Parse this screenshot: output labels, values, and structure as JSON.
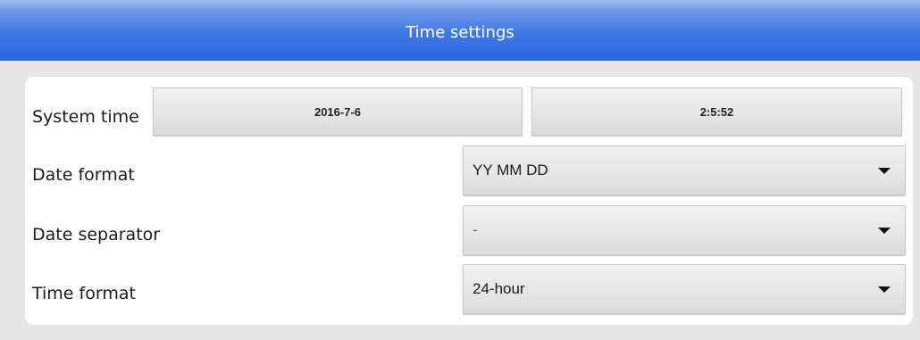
{
  "header": {
    "title": "Time settings"
  },
  "rows": {
    "system_time": {
      "label": "System time",
      "date_value": "2016-7-6",
      "time_value": "2:5:52"
    },
    "date_format": {
      "label": "Date format",
      "value": "YY MM DD"
    },
    "date_separator": {
      "label": "Date separator",
      "value": "-"
    },
    "time_format": {
      "label": "Time format",
      "value": "24-hour"
    }
  },
  "icons": {
    "dropdown": "chevron-down-icon"
  },
  "colors": {
    "header_blue": "#3f78e3",
    "background": "#e6e6e6",
    "panel": "#ffffff"
  }
}
